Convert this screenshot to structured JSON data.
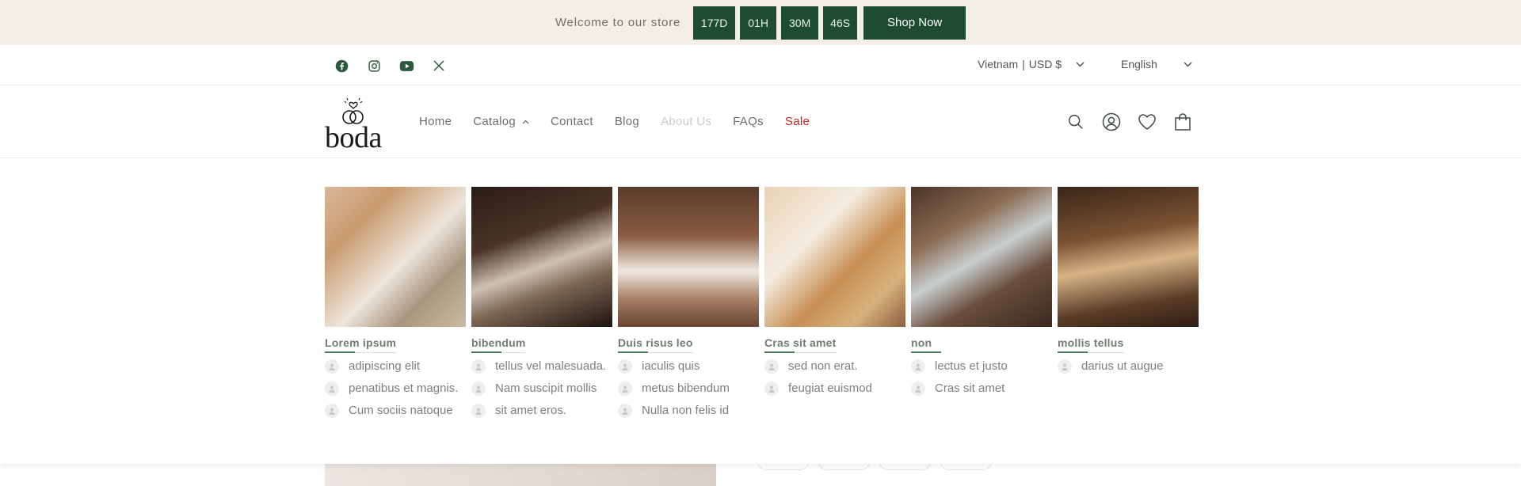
{
  "announcement": {
    "welcome": "Welcome to our store",
    "countdown": {
      "days": "177D",
      "hours": "01H",
      "minutes": "30M",
      "seconds": "46S"
    },
    "cta_label": "Shop Now"
  },
  "utility": {
    "social_icons": [
      "facebook-icon",
      "instagram-icon",
      "youtube-icon",
      "x-icon"
    ],
    "country": "Vietnam",
    "separator": "|",
    "currency": "USD $",
    "language": "English"
  },
  "header": {
    "logo_text": "boda",
    "nav": [
      {
        "label": "Home"
      },
      {
        "label": "Catalog"
      },
      {
        "label": "Contact"
      },
      {
        "label": "Blog"
      },
      {
        "label": "About Us"
      },
      {
        "label": "FAQs"
      },
      {
        "label": "Sale"
      }
    ],
    "icons": [
      "search-icon",
      "account-icon",
      "wishlist-icon",
      "cart-icon"
    ]
  },
  "mega_menu": {
    "columns": [
      {
        "title": "Lorem ipsum",
        "links": [
          "adipiscing elit",
          "penatibus et magnis.",
          "Cum sociis natoque"
        ]
      },
      {
        "title": "bibendum",
        "links": [
          "tellus vel malesuada.",
          "Nam suscipit mollis",
          "sit amet eros."
        ]
      },
      {
        "title": "Duis risus leo",
        "links": [
          "iaculis quis",
          "metus bibendum",
          "Nulla non felis id"
        ]
      },
      {
        "title": "Cras sit amet",
        "links": [
          "sed non erat.",
          "feugiat euismod"
        ]
      },
      {
        "title": "non",
        "links": [
          "lectus et justo",
          "Cras sit amet"
        ]
      },
      {
        "title": "mollis tellus",
        "links": [
          "darius ut augue"
        ]
      }
    ]
  },
  "colors": {
    "brand_green": "#1d4c31",
    "announcement_bg": "#f4eee9",
    "sale_red": "#d2241d"
  }
}
